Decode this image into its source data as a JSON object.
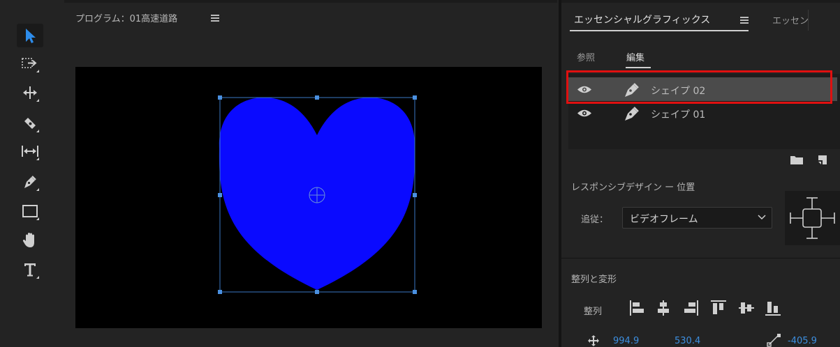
{
  "monitor": {
    "title": "プログラム：01高速道路"
  },
  "panel": {
    "tabs": [
      {
        "label": "エッセンシャルグラフィックス",
        "active": true
      },
      {
        "label": "エッセン",
        "active": false
      }
    ],
    "subtabs": [
      {
        "label": "参照",
        "active": false
      },
      {
        "label": "編集",
        "active": true
      }
    ],
    "layers": [
      {
        "name": "シェイプ 02",
        "selected": true
      },
      {
        "name": "シェイプ 01",
        "selected": false
      }
    ],
    "responsive_label": "レスポンシブデザイン ー 位置",
    "follow_label": "追従：",
    "follow_value": "ビデオフレーム",
    "align_section_label": "整列と変形",
    "align_label": "整列",
    "position_x": "994.9",
    "position_y": "530.4",
    "anchor_value": "-405.9"
  },
  "colors": {
    "shape_fill": "#0a0aff",
    "highlight": "#e01010",
    "value_blue": "#3d8fe0",
    "tool_active": "#2d8ceb"
  }
}
